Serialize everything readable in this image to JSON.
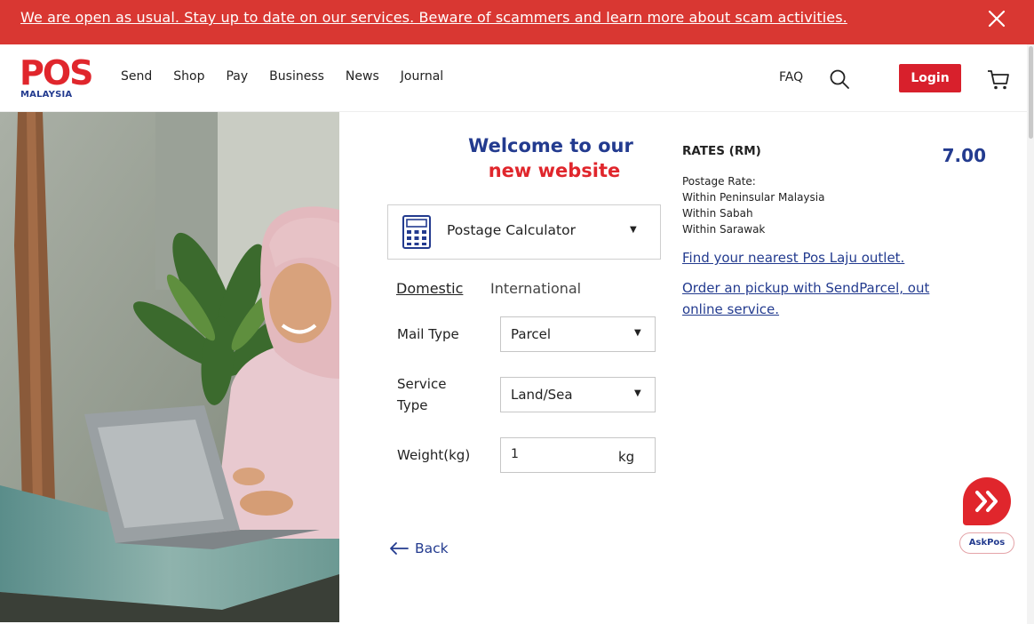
{
  "alert": {
    "message": "We are open as usual. Stay up to date on our services. Beware of scammers and learn more about scam activities.",
    "close_icon": "close-icon"
  },
  "brand": {
    "name": "POS",
    "subname": "MALAYSIA",
    "primary_color": "#e0262c",
    "secondary_color": "#233b8f",
    "banner_color": "#d93732"
  },
  "nav": {
    "items": [
      "Send",
      "Shop",
      "Pay",
      "Business",
      "News",
      "Journal"
    ],
    "faq": "FAQ",
    "login": "Login",
    "search_icon": "search-icon",
    "cart_icon": "cart-icon"
  },
  "hero": {
    "image": "woman-with-laptop-photo"
  },
  "calculator": {
    "welcome_line1": "Welcome to our",
    "welcome_line2": "new website",
    "selector_label": "Postage Calculator",
    "selector_icon": "calculator-icon",
    "tabs": [
      "Domestic",
      "International"
    ],
    "active_tab": "Domestic",
    "mail_type_label": "Mail Type",
    "mail_type_value": "Parcel",
    "service_type_label_1": "Service",
    "service_type_label_2": "Type",
    "service_type_value": "Land/Sea",
    "weight_label": "Weight(kg)",
    "weight_value": "1",
    "weight_unit": "kg",
    "back_label": "Back"
  },
  "rates": {
    "title": "RATES (RM)",
    "value": "7.00",
    "lines": [
      "Postage Rate:",
      "Within Peninsular Malaysia",
      "Within Sabah",
      "Within Sarawak"
    ],
    "link_outlet": "Find your nearest Pos Laju outlet.",
    "link_pickup": "Order an pickup with SendParcel, out online service."
  },
  "askpos": {
    "label": "AskPos",
    "icon": "chevrons-right-icon"
  }
}
